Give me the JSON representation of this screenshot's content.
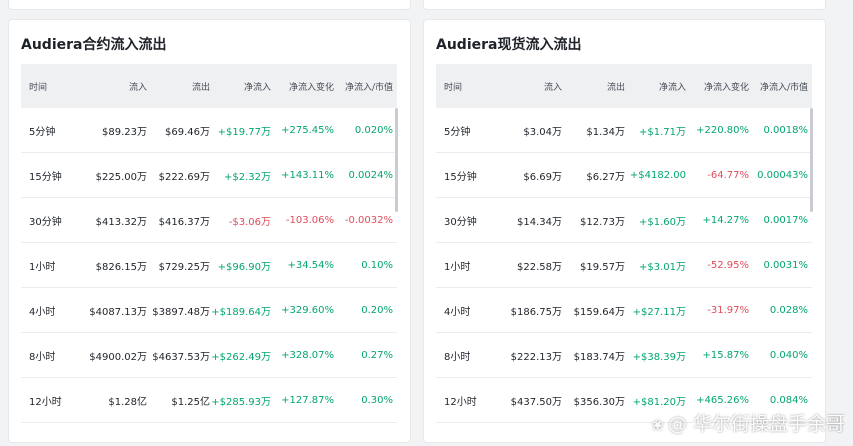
{
  "contract": {
    "title": "Audiera合约流入流出",
    "headers": [
      "时间",
      "流入",
      "流出",
      "净流入",
      "净流入变化",
      "净流入/市值"
    ],
    "rows": [
      {
        "time": "5分钟",
        "inflow": "$89.23万",
        "outflow": "$69.46万",
        "net": "+$19.77万",
        "change": "+275.45%",
        "ratio": "0.020%",
        "net_s": "pos",
        "change_s": "pos",
        "ratio_s": "pos"
      },
      {
        "time": "15分钟",
        "inflow": "$225.00万",
        "outflow": "$222.69万",
        "net": "+$2.32万",
        "change": "+143.11%",
        "ratio": "0.0024%",
        "net_s": "pos",
        "change_s": "pos",
        "ratio_s": "pos"
      },
      {
        "time": "30分钟",
        "inflow": "$413.32万",
        "outflow": "$416.37万",
        "net": "-$3.06万",
        "change": "-103.06%",
        "ratio": "-0.0032%",
        "net_s": "neg",
        "change_s": "neg",
        "ratio_s": "neg"
      },
      {
        "time": "1小时",
        "inflow": "$826.15万",
        "outflow": "$729.25万",
        "net": "+$96.90万",
        "change": "+34.54%",
        "ratio": "0.10%",
        "net_s": "pos",
        "change_s": "pos",
        "ratio_s": "pos"
      },
      {
        "time": "4小时",
        "inflow": "$4087.13万",
        "outflow": "$3897.48万",
        "net": "+$189.64万",
        "change": "+329.60%",
        "ratio": "0.20%",
        "net_s": "pos",
        "change_s": "pos",
        "ratio_s": "pos"
      },
      {
        "time": "8小时",
        "inflow": "$4900.02万",
        "outflow": "$4637.53万",
        "net": "+$262.49万",
        "change": "+328.07%",
        "ratio": "0.27%",
        "net_s": "pos",
        "change_s": "pos",
        "ratio_s": "pos"
      },
      {
        "time": "12小时",
        "inflow": "$1.28亿",
        "outflow": "$1.25亿",
        "net": "+$285.93万",
        "change": "+127.87%",
        "ratio": "0.30%",
        "net_s": "pos",
        "change_s": "pos",
        "ratio_s": "pos"
      }
    ]
  },
  "spot": {
    "title": "Audiera现货流入流出",
    "headers": [
      "时间",
      "流入",
      "流出",
      "净流入",
      "净流入变化",
      "净流入/市值"
    ],
    "rows": [
      {
        "time": "5分钟",
        "inflow": "$3.04万",
        "outflow": "$1.34万",
        "net": "+$1.71万",
        "change": "+220.80%",
        "ratio": "0.0018%",
        "net_s": "pos",
        "change_s": "pos",
        "ratio_s": "pos"
      },
      {
        "time": "15分钟",
        "inflow": "$6.69万",
        "outflow": "$6.27万",
        "net": "+$4182.00",
        "change": "-64.77%",
        "ratio": "0.00043%",
        "net_s": "pos",
        "change_s": "neg",
        "ratio_s": "pos"
      },
      {
        "time": "30分钟",
        "inflow": "$14.34万",
        "outflow": "$12.73万",
        "net": "+$1.60万",
        "change": "+14.27%",
        "ratio": "0.0017%",
        "net_s": "pos",
        "change_s": "pos",
        "ratio_s": "pos"
      },
      {
        "time": "1小时",
        "inflow": "$22.58万",
        "outflow": "$19.57万",
        "net": "+$3.01万",
        "change": "-52.95%",
        "ratio": "0.0031%",
        "net_s": "pos",
        "change_s": "neg",
        "ratio_s": "pos"
      },
      {
        "time": "4小时",
        "inflow": "$186.75万",
        "outflow": "$159.64万",
        "net": "+$27.11万",
        "change": "-31.97%",
        "ratio": "0.028%",
        "net_s": "pos",
        "change_s": "neg",
        "ratio_s": "pos"
      },
      {
        "time": "8小时",
        "inflow": "$222.13万",
        "outflow": "$183.74万",
        "net": "+$38.39万",
        "change": "+15.87%",
        "ratio": "0.040%",
        "net_s": "pos",
        "change_s": "pos",
        "ratio_s": "pos"
      },
      {
        "time": "12小时",
        "inflow": "$437.50万",
        "outflow": "$356.30万",
        "net": "+$81.20万",
        "change": "+465.26%",
        "ratio": "0.084%",
        "net_s": "pos",
        "change_s": "pos",
        "ratio_s": "pos"
      }
    ]
  },
  "watermark": {
    "text": "@ 华尔街操盘手余哥",
    "icon": "paw-icon"
  },
  "colors": {
    "positive": "#03a66d",
    "negative": "#e24b5b",
    "header_bg": "#eef0f2"
  }
}
